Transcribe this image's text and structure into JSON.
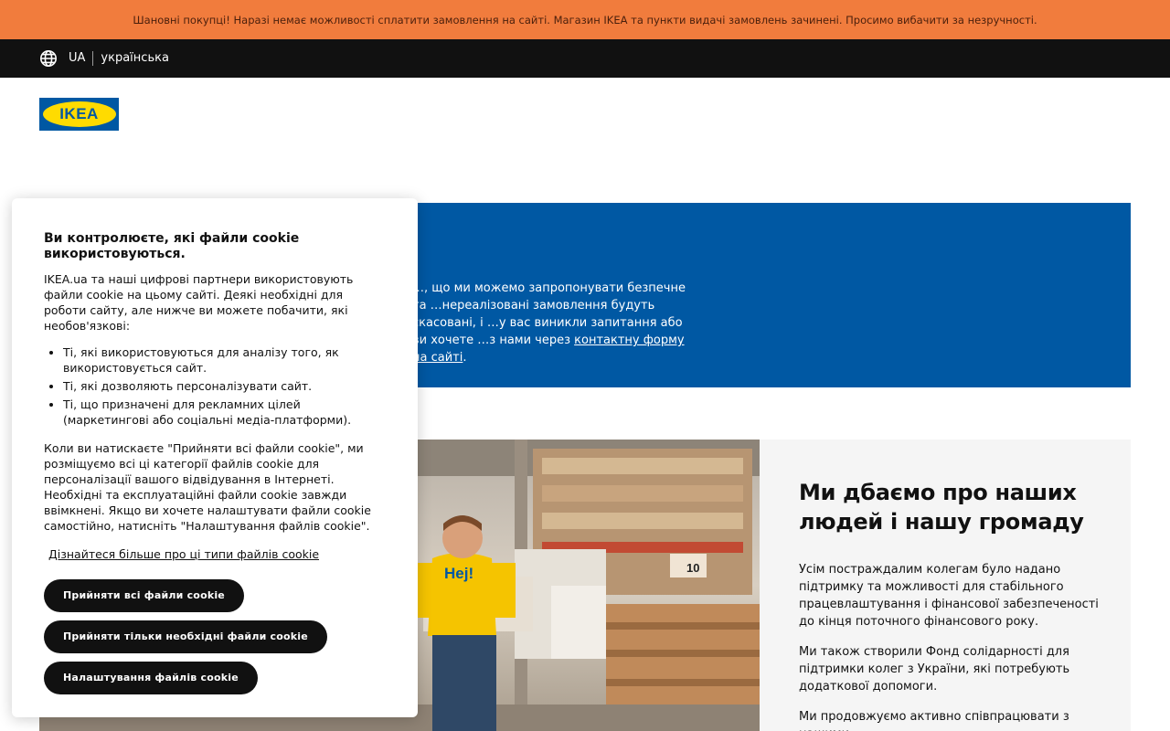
{
  "announcement": {
    "text": "Шановні покупці! Наразі немає можливості сплатити замовлення на сайті. Магазин IKEA та пункти видачі замовлень зачинені. Просимо вибачити за незручності."
  },
  "lang_bar": {
    "globe_icon": "globe-icon",
    "country": "UA",
    "language": "українська"
  },
  "logo": {
    "text": "IKEA"
  },
  "blue_notice": {
    "body": "…, що ми можемо запропонувати безпечне та …нереалізовані замовлення будуть скасовані, і …у вас виникли запитання або ви хочете …з нами через ",
    "link": "контактну форму на сайті",
    "end": "."
  },
  "info_panel": {
    "heading": "Ми дбаємо про наших людей і нашу громаду",
    "p1": "Усім постраждалим колегам було надано підтримку та можливості для стабільного працевлаштування і фінансової забезпеченості до кінця поточного фінансового року.",
    "p2": "Ми також створили Фонд солідарності для підтримки колег з України, які потребують додаткової допомоги.",
    "p3": "Ми продовжуємо активно співпрацювати з нашими"
  },
  "photo": {
    "shirt_text": "Hej!",
    "aisle_number": "10"
  },
  "cookie": {
    "title": "Ви контролюєте, які файли cookie використовуються.",
    "intro": "IKEA.ua та наші цифрові партнери використовують файли cookie на цьому сайті. Деякі необхідні для роботи сайту, але нижче ви можете побачити, які необов'язкові:",
    "bullets": [
      "Ті, які використовуються для аналізу того, як використовується сайт.",
      "Ті, які дозволяють персоналізувати сайт.",
      "Ті, що призначені для рекламних цілей (маркетингові або соціальні медіа-платформи)."
    ],
    "para": "Коли ви натискаєте \"Прийняти всі файли cookie\", ми розміщуємо всі ці категорії файлів cookie для персоналізації вашого відвідування в Інтернеті. Необхідні та експлуатаційні файли cookie завжди ввімкнені. Якщо ви хочете налаштувати файли cookie самостійно, натисніть \"Налаштування файлів cookie\".",
    "learn_more": "Дізнайтеся більше про ці типи файлів cookie",
    "accept_all": "Прийняти всі файли cookie",
    "accept_necessary": "Прийняти тільки необхідні файли cookie",
    "settings": "Налаштування файлів cookie"
  },
  "colors": {
    "announcement_bg": "#f17c3d",
    "lang_bar_bg": "#111111",
    "ikea_blue": "#0058a3",
    "ikea_yellow": "#ffdb00",
    "panel_bg": "#f5f5f5"
  }
}
